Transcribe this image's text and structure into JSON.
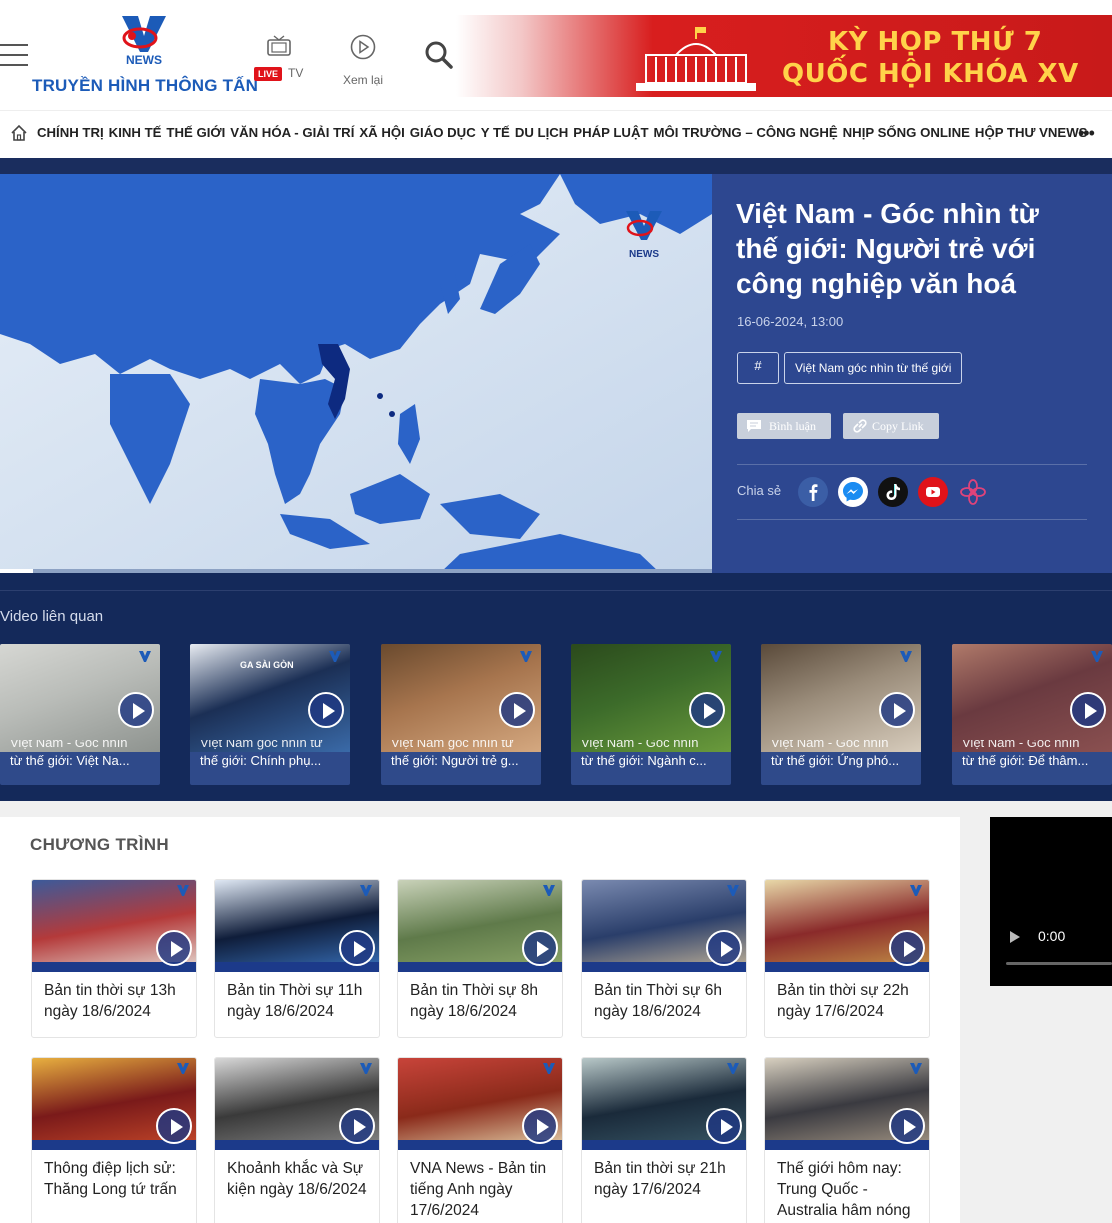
{
  "header": {
    "logo_text": "TRUYỀN HÌNH THÔNG TẤN",
    "logo_caption": "NEWS",
    "live_badge": "LIVE",
    "tv_label": "TV",
    "replay_label": "Xem lại",
    "banner_line1": "KỲ HỌP THỨ 7",
    "banner_line2": "QUỐC HỘI KHÓA XV"
  },
  "nav": {
    "items": [
      "CHÍNH TRỊ",
      "KINH TẾ",
      "THẾ GIỚI",
      "VĂN HÓA - GIẢI TRÍ",
      "XÃ HỘI",
      "GIÁO DỤC",
      "Y TẾ",
      "DU LỊCH",
      "PHÁP LUẬT",
      "MÔI TRƯỜNG – CÔNG NGHỆ",
      "NHỊP SỐNG ONLINE",
      "HỘP THƯ VNEWS"
    ],
    "more": "•••"
  },
  "hero": {
    "title": "Việt Nam - Góc nhìn từ thế giới: Người trẻ với công nghiệp văn hoá",
    "date": "16-06-2024, 13:00",
    "tag_hash": "#",
    "tag": "Việt Nam góc nhìn từ thế giới",
    "comment_label": "Bình luận",
    "copy_label": "Copy Link",
    "share_label": "Chia sẻ",
    "video_logo": "NEWS",
    "progress": 0.046
  },
  "related": {
    "title": "Video liên quan",
    "items": [
      {
        "line1": "Việt Nam - Góc nhìn",
        "line2": "từ thế giới: Việt Na..."
      },
      {
        "line1": "Việt Nam góc nhìn từ",
        "line2": "thế giới: Chính phụ...",
        "sign": "GA SÀI GÒN"
      },
      {
        "line1": "Việt Nam góc nhìn từ",
        "line2": "thế giới: Người trẻ g..."
      },
      {
        "line1": "Việt Nam - Góc nhìn",
        "line2": "từ thế giới: Ngành c..."
      },
      {
        "line1": "Việt Nam - Góc nhìn",
        "line2": "từ thế giới: Ứng phó..."
      },
      {
        "line1": "Việt Nam - Góc nhìn",
        "line2": "từ thế giới: Để thâm..."
      }
    ]
  },
  "programs": {
    "title": "CHƯƠNG TRÌNH",
    "row1": [
      "Bản tin thời sự 13h ngày 18/6/2024",
      "Bản tin Thời sự 11h ngày 18/6/2024",
      "Bản tin Thời sự 8h ngày 18/6/2024",
      "Bản tin Thời sự 6h ngày 18/6/2024",
      "Bản tin thời sự 22h ngày 17/6/2024"
    ],
    "row2": [
      "Thông điệp lịch sử: Thăng Long tứ trấn",
      "Khoảnh khắc và Sự kiện ngày 18/6/2024",
      "VNA News - Bản tin tiếng Anh ngày 17/6/2024",
      "Bản tin thời sự 21h ngày 17/6/2024",
      "Thế giới hôm nay: Trung Quốc - Australia hâm nóng"
    ]
  },
  "side_video": {
    "time": "0:00"
  },
  "colors": {
    "brand_blue": "#1c5bb8",
    "hero_dark": "#14295a",
    "hero_info": "#2d4790",
    "live_red": "#e0131a"
  }
}
